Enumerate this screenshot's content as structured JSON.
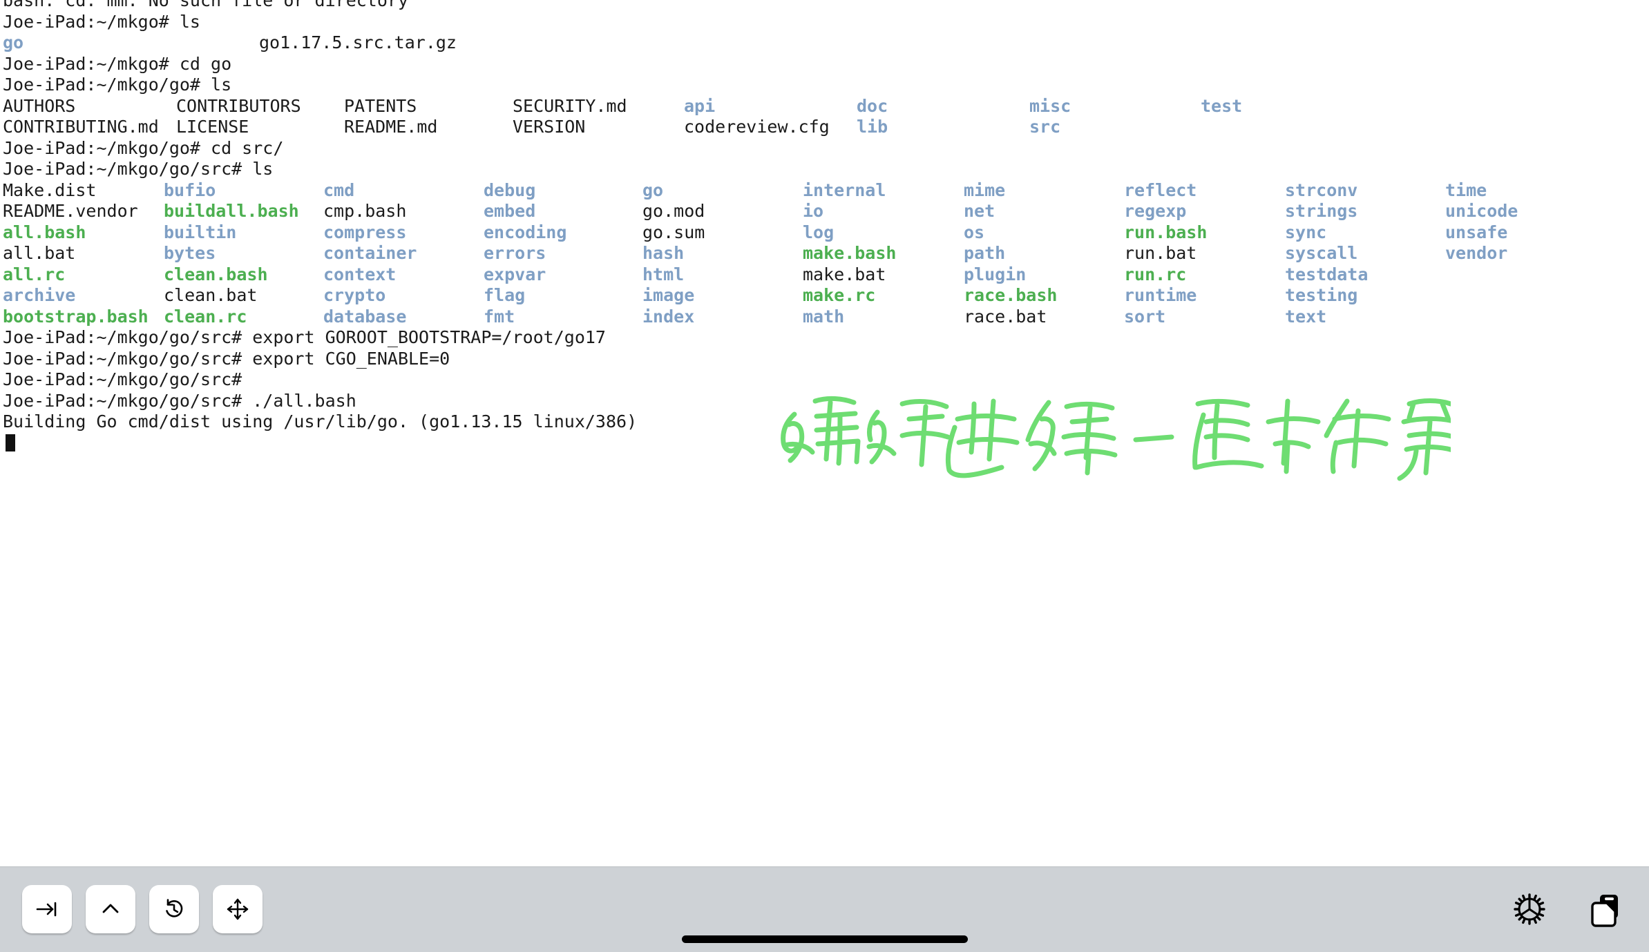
{
  "terminal": {
    "prompt_user": "Joe-iPad",
    "lines": [
      {
        "type": "text",
        "clipped": true,
        "text": "bash: cd: mm: No such file or directory"
      },
      {
        "type": "text",
        "text": "Joe-iPad:~/mkgo# ls"
      },
      {
        "type": "grid",
        "columns": [
          4,
          375
        ],
        "cells": [
          {
            "text": "go",
            "style": "dir"
          },
          {
            "text": "go1.17.5.src.tar.gz",
            "style": "default"
          }
        ]
      },
      {
        "type": "text",
        "text": "Joe-iPad:~/mkgo# cd go"
      },
      {
        "type": "text",
        "text": "Joe-iPad:~/mkgo/go# ls"
      },
      {
        "type": "grid",
        "columns": [
          4,
          255,
          498,
          742,
          990,
          1240,
          1490,
          1738
        ],
        "cells": [
          {
            "text": "AUTHORS",
            "style": "default"
          },
          {
            "text": "CONTRIBUTORS",
            "style": "default"
          },
          {
            "text": "PATENTS",
            "style": "default"
          },
          {
            "text": "SECURITY.md",
            "style": "default"
          },
          {
            "text": "api",
            "style": "dir"
          },
          {
            "text": "doc",
            "style": "dir"
          },
          {
            "text": "misc",
            "style": "dir"
          },
          {
            "text": "test",
            "style": "dir"
          }
        ]
      },
      {
        "type": "grid",
        "columns": [
          4,
          255,
          498,
          742,
          990,
          1240,
          1490,
          1738
        ],
        "cells": [
          {
            "text": "CONTRIBUTING.md",
            "style": "default"
          },
          {
            "text": "LICENSE",
            "style": "default"
          },
          {
            "text": "README.md",
            "style": "default"
          },
          {
            "text": "VERSION",
            "style": "default"
          },
          {
            "text": "codereview.cfg",
            "style": "default"
          },
          {
            "text": "lib",
            "style": "dir"
          },
          {
            "text": "src",
            "style": "dir"
          },
          {
            "text": "",
            "style": "default"
          }
        ]
      },
      {
        "type": "text",
        "text": "Joe-iPad:~/mkgo/go# cd src/"
      },
      {
        "type": "text",
        "text": "Joe-iPad:~/mkgo/go/src# ls"
      },
      {
        "type": "grid",
        "columns": [
          4,
          237,
          468,
          700,
          930,
          1162,
          1395,
          1627,
          1860,
          2092
        ],
        "cells": [
          {
            "text": "Make.dist",
            "style": "default"
          },
          {
            "text": "bufio",
            "style": "dir"
          },
          {
            "text": "cmd",
            "style": "dir"
          },
          {
            "text": "debug",
            "style": "dir"
          },
          {
            "text": "go",
            "style": "dir"
          },
          {
            "text": "internal",
            "style": "dir"
          },
          {
            "text": "mime",
            "style": "dir"
          },
          {
            "text": "reflect",
            "style": "dir"
          },
          {
            "text": "strconv",
            "style": "dir"
          },
          {
            "text": "time",
            "style": "dir"
          }
        ]
      },
      {
        "type": "grid",
        "columns": [
          4,
          237,
          468,
          700,
          930,
          1162,
          1395,
          1627,
          1860,
          2092
        ],
        "cells": [
          {
            "text": "README.vendor",
            "style": "default"
          },
          {
            "text": "buildall.bash",
            "style": "exec"
          },
          {
            "text": "cmp.bash",
            "style": "default"
          },
          {
            "text": "embed",
            "style": "dir"
          },
          {
            "text": "go.mod",
            "style": "default"
          },
          {
            "text": "io",
            "style": "dir"
          },
          {
            "text": "net",
            "style": "dir"
          },
          {
            "text": "regexp",
            "style": "dir"
          },
          {
            "text": "strings",
            "style": "dir"
          },
          {
            "text": "unicode",
            "style": "dir"
          }
        ]
      },
      {
        "type": "grid",
        "columns": [
          4,
          237,
          468,
          700,
          930,
          1162,
          1395,
          1627,
          1860,
          2092
        ],
        "cells": [
          {
            "text": "all.bash",
            "style": "exec"
          },
          {
            "text": "builtin",
            "style": "dir"
          },
          {
            "text": "compress",
            "style": "dir"
          },
          {
            "text": "encoding",
            "style": "dir"
          },
          {
            "text": "go.sum",
            "style": "default"
          },
          {
            "text": "log",
            "style": "dir"
          },
          {
            "text": "os",
            "style": "dir"
          },
          {
            "text": "run.bash",
            "style": "exec"
          },
          {
            "text": "sync",
            "style": "dir"
          },
          {
            "text": "unsafe",
            "style": "dir"
          }
        ]
      },
      {
        "type": "grid",
        "columns": [
          4,
          237,
          468,
          700,
          930,
          1162,
          1395,
          1627,
          1860,
          2092
        ],
        "cells": [
          {
            "text": "all.bat",
            "style": "default"
          },
          {
            "text": "bytes",
            "style": "dir"
          },
          {
            "text": "container",
            "style": "dir"
          },
          {
            "text": "errors",
            "style": "dir"
          },
          {
            "text": "hash",
            "style": "dir"
          },
          {
            "text": "make.bash",
            "style": "exec"
          },
          {
            "text": "path",
            "style": "dir"
          },
          {
            "text": "run.bat",
            "style": "default"
          },
          {
            "text": "syscall",
            "style": "dir"
          },
          {
            "text": "vendor",
            "style": "dir"
          }
        ]
      },
      {
        "type": "grid",
        "columns": [
          4,
          237,
          468,
          700,
          930,
          1162,
          1395,
          1627,
          1860,
          2092
        ],
        "cells": [
          {
            "text": "all.rc",
            "style": "exec"
          },
          {
            "text": "clean.bash",
            "style": "exec"
          },
          {
            "text": "context",
            "style": "dir"
          },
          {
            "text": "expvar",
            "style": "dir"
          },
          {
            "text": "html",
            "style": "dir"
          },
          {
            "text": "make.bat",
            "style": "default"
          },
          {
            "text": "plugin",
            "style": "dir"
          },
          {
            "text": "run.rc",
            "style": "exec"
          },
          {
            "text": "testdata",
            "style": "dir"
          },
          {
            "text": "",
            "style": "default"
          }
        ]
      },
      {
        "type": "grid",
        "columns": [
          4,
          237,
          468,
          700,
          930,
          1162,
          1395,
          1627,
          1860,
          2092
        ],
        "cells": [
          {
            "text": "archive",
            "style": "dir"
          },
          {
            "text": "clean.bat",
            "style": "default"
          },
          {
            "text": "crypto",
            "style": "dir"
          },
          {
            "text": "flag",
            "style": "dir"
          },
          {
            "text": "image",
            "style": "dir"
          },
          {
            "text": "make.rc",
            "style": "exec"
          },
          {
            "text": "race.bash",
            "style": "exec"
          },
          {
            "text": "runtime",
            "style": "dir"
          },
          {
            "text": "testing",
            "style": "dir"
          },
          {
            "text": "",
            "style": "default"
          }
        ]
      },
      {
        "type": "grid",
        "columns": [
          4,
          237,
          468,
          700,
          930,
          1162,
          1395,
          1627,
          1860,
          2092
        ],
        "cells": [
          {
            "text": "bootstrap.bash",
            "style": "exec"
          },
          {
            "text": "clean.rc",
            "style": "exec"
          },
          {
            "text": "database",
            "style": "dir"
          },
          {
            "text": "fmt",
            "style": "dir"
          },
          {
            "text": "index",
            "style": "dir"
          },
          {
            "text": "math",
            "style": "dir"
          },
          {
            "text": "race.bat",
            "style": "default"
          },
          {
            "text": "sort",
            "style": "dir"
          },
          {
            "text": "text",
            "style": "dir"
          },
          {
            "text": "",
            "style": "default"
          }
        ]
      },
      {
        "type": "text",
        "text": "Joe-iPad:~/mkgo/go/src# export GOROOT_BOOTSTRAP=/root/go17"
      },
      {
        "type": "text",
        "text": "Joe-iPad:~/mkgo/go/src# export CGO_ENABLE=0"
      },
      {
        "type": "text",
        "text": "Joe-iPad:~/mkgo/go/src#"
      },
      {
        "type": "text",
        "text": "Joe-iPad:~/mkgo/go/src# ./all.bash"
      },
      {
        "type": "text",
        "text": "Building Go cmd/dist using /usr/lib/go. (go1.13.15 linux/386)"
      },
      {
        "type": "cursor",
        "text": ""
      }
    ]
  },
  "annotation": {
    "text": "编译进程一直卡在第1步",
    "color": "#6edd72",
    "meaning": "handwritten-note"
  },
  "toolbar": {
    "background_color": "#ced2d6",
    "left_keys": [
      {
        "name": "tab-key",
        "label": "Tab"
      },
      {
        "name": "ctrl-key",
        "label": "Ctrl"
      },
      {
        "name": "history-key",
        "label": "History"
      },
      {
        "name": "arrows-key",
        "label": "Arrow keys"
      }
    ],
    "right_icons": [
      {
        "name": "settings-gear",
        "label": "Settings"
      },
      {
        "name": "copy-paste",
        "label": "Copy / Paste"
      }
    ]
  },
  "colors": {
    "terminal_bg": "#ffffff",
    "terminal_fg": "#1b1b1b",
    "dir_blue": "#7f9fc4",
    "exec_green": "#4caf50",
    "annotation_green": "#6edd72"
  }
}
